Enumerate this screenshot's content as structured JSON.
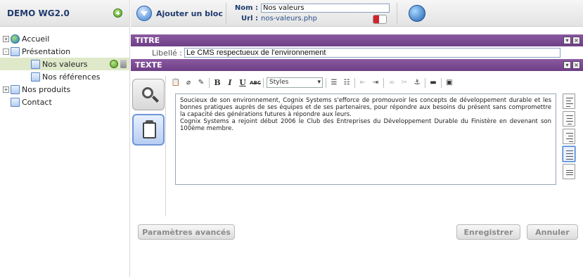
{
  "sidebar": {
    "site_title": "DEMO WG2.0",
    "tree": [
      {
        "label": "Accueil",
        "toggle": "+"
      },
      {
        "label": "Présentation",
        "toggle": "-"
      },
      {
        "label": "Nos valeurs"
      },
      {
        "label": "Nos références"
      },
      {
        "label": "Nos produits",
        "toggle": "+"
      },
      {
        "label": "Contact"
      }
    ]
  },
  "toolbar": {
    "add_block_label": "Ajouter un bloc",
    "nom_label": "Nom :",
    "nom_value": "Nos valeurs",
    "url_label": "Url :",
    "url_value": "nos-valeurs.php"
  },
  "titre": {
    "header": "TITRE",
    "libelle_label": "Libellé :",
    "libelle_value": "Le CMS respectueux de l'environnement"
  },
  "texte": {
    "header": "TEXTE",
    "styles_value": "Styles",
    "body_lines": [
      "Soucieux de son environnement, Cognix Systems s'efforce de promouvoir les concepts de développement durable et les bonnes pratiques auprès de ses équipes et de ses partenaires, pour répondre aux besoins du présent sans compromettre la capacité des générations futures à répondre aux leurs.",
      "Cognix Systems a rejoint début 2006 le Club des Entreprises du Développement Durable du Finistère en devenant son 100ème membre."
    ]
  },
  "actions": {
    "advanced_label": "Paramètres avancés",
    "save_label": "Enregistrer",
    "cancel_label": "Annuler"
  },
  "header_bar_buttons": {
    "minimize": "▾",
    "close": "×"
  },
  "colors": {
    "section_bar": "#6e3f86",
    "brand_text": "#1f3b6e",
    "selected_row": "#dfe9ca"
  }
}
